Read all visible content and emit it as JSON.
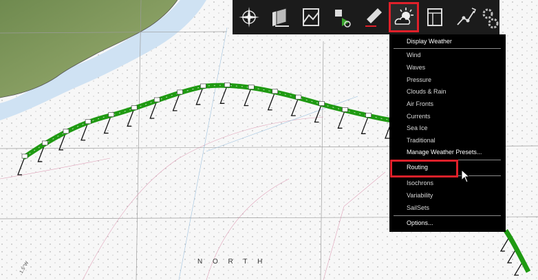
{
  "map": {
    "label_north": "N O R T H"
  },
  "toolbar": {
    "buttons": [
      {
        "name": "compass-rose-icon"
      },
      {
        "name": "chart-layers-icon"
      },
      {
        "name": "chart-window-icon"
      },
      {
        "name": "route-tools-icon"
      },
      {
        "name": "draw-pencil-icon"
      },
      {
        "name": "weather-sun-cloud-icon",
        "selected": true
      },
      {
        "name": "table-panel-icon"
      },
      {
        "name": "waypoint-route-icon"
      },
      {
        "name": "gear-icon"
      }
    ]
  },
  "weather_menu": {
    "header": "Display Weather",
    "items_group1": [
      "Wind",
      "Waves",
      "Pressure",
      "Clouds & Rain",
      "Air Fronts",
      "Currents",
      "Sea Ice",
      "Traditional"
    ],
    "manage_presets": "Manage Weather Presets...",
    "routing": "Routing",
    "items_group2": [
      "Isochrons",
      "Variability",
      "SailSets"
    ],
    "options": "Options..."
  },
  "colors": {
    "route_green": "#1f9a12",
    "highlight_red": "#e0202a",
    "menu_bg": "#000000",
    "toolbar_bg": "#1b1b1b"
  }
}
